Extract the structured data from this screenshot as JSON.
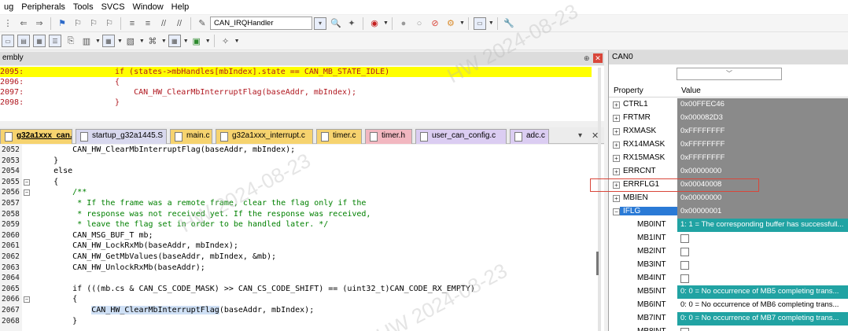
{
  "menu": [
    "ug",
    "Peripherals",
    "Tools",
    "SVCS",
    "Window",
    "Help"
  ],
  "toolbar1": {
    "target_combo": "CAN_IRQHandler"
  },
  "disassembly": {
    "title": "embly",
    "lines": [
      {
        "num": "2095:",
        "code": "if (states->mbHandles[mbIndex].state == CAN_MB_STATE_IDLE)",
        "highlight": true
      },
      {
        "num": "2096:",
        "code": "{"
      },
      {
        "num": "2097:",
        "code": "    CAN_HW_ClearMbInterruptFlag(baseAddr, mbIndex);"
      },
      {
        "num": "2098:",
        "code": "}"
      }
    ]
  },
  "tabs": [
    {
      "label": "g32a1xxx_can.c",
      "color": "#f6d36f",
      "active": true
    },
    {
      "label": "startup_g32a1445.S",
      "color": "#d8d8ee"
    },
    {
      "label": "main.c",
      "color": "#f6d36f"
    },
    {
      "label": "g32a1xxx_interrupt.c",
      "color": "#f6d36f"
    },
    {
      "label": "timer.c",
      "color": "#f6d36f"
    },
    {
      "label": "timer.h",
      "color": "#f2b7c0"
    },
    {
      "label": "user_can_config.c",
      "color": "#dbcdf2"
    },
    {
      "label": "adc.c",
      "color": "#dbcdf2"
    }
  ],
  "editor": {
    "lines": [
      {
        "num": "2052",
        "code": "        CAN_HW_ClearMbInterruptFlag(baseAddr, mbIndex);"
      },
      {
        "num": "2053",
        "code": "    }"
      },
      {
        "num": "2054",
        "code": "    else"
      },
      {
        "num": "2055",
        "code": "    {",
        "fold": true
      },
      {
        "num": "2056",
        "code": "        /**",
        "fold": true,
        "comment": true
      },
      {
        "num": "2057",
        "code": "         * If the frame was a remote frame, clear the flag only if the",
        "comment": true
      },
      {
        "num": "2058",
        "code": "         * response was not received yet. If the response was received,",
        "comment": true
      },
      {
        "num": "2059",
        "code": "         * leave the flag set in order to be handled later. */",
        "comment": true
      },
      {
        "num": "2060",
        "code": "        CAN_MSG_BUF_T mb;"
      },
      {
        "num": "2061",
        "code": "        CAN_HW_LockRxMb(baseAddr, mbIndex);"
      },
      {
        "num": "2062",
        "code": "        CAN_HW_GetMbValues(baseAddr, mbIndex, &mb);"
      },
      {
        "num": "2063",
        "code": "        CAN_HW_UnlockRxMb(baseAddr);"
      },
      {
        "num": "2064",
        "code": ""
      },
      {
        "num": "2065",
        "code": "        if (((mb.cs & CAN_CS_CODE_MASK) >> CAN_CS_CODE_SHIFT) == (uint32_t)CAN_CODE_RX_EMPTY)"
      },
      {
        "num": "2066",
        "code": "        {",
        "fold": true
      },
      {
        "num": "2067",
        "code": "            CAN_HW_ClearMbInterruptFlag(baseAddr, mbIndex);",
        "highlight_call": true
      },
      {
        "num": "2068",
        "code": "        }"
      }
    ]
  },
  "properties": {
    "title": "CAN0",
    "col_property": "Property",
    "col_value": "Value",
    "rows": [
      {
        "name": "CTRL1",
        "value": "0x00FFEC46",
        "style": "gray",
        "exp": "+"
      },
      {
        "name": "FRTMR",
        "value": "0x000082D3",
        "style": "gray",
        "exp": "+"
      },
      {
        "name": "RXMASK",
        "value": "0xFFFFFFFF",
        "style": "gray",
        "exp": "+"
      },
      {
        "name": "RX14MASK",
        "value": "0xFFFFFFFF",
        "style": "gray",
        "exp": "+"
      },
      {
        "name": "RX15MASK",
        "value": "0xFFFFFFFF",
        "style": "gray",
        "exp": "+"
      },
      {
        "name": "ERRCNT",
        "value": "0x00000000",
        "style": "gray",
        "exp": "+"
      },
      {
        "name": "ERRFLG1",
        "value": "0x00040008",
        "style": "gray",
        "exp": "+"
      },
      {
        "name": "MBIEN",
        "value": "0x00000000",
        "style": "gray",
        "exp": "+"
      },
      {
        "name": "IFLG",
        "value": "0x00000001",
        "style": "gray",
        "exp": "-",
        "selected": true
      },
      {
        "name": "MB0INT",
        "value": "1: 1 = The corresponding buffer has successfull...",
        "style": "teal",
        "sub": true
      },
      {
        "name": "MB1INT",
        "value": "",
        "style": "check",
        "sub": true
      },
      {
        "name": "MB2INT",
        "value": "",
        "style": "check",
        "sub": true
      },
      {
        "name": "MB3INT",
        "value": "",
        "style": "check",
        "sub": true
      },
      {
        "name": "MB4INT",
        "value": "",
        "style": "check",
        "sub": true
      },
      {
        "name": "MB5INT",
        "value": "0: 0 = No occurrence of MB5 completing trans...",
        "style": "teal",
        "sub": true
      },
      {
        "name": "MB6INT",
        "value": "0: 0 = No occurrence of MB6 completing trans...",
        "style": "plain",
        "sub": true
      },
      {
        "name": "MB7INT",
        "value": "0: 0 = No occurrence of MB7 completing trans...",
        "style": "teal",
        "sub": true
      },
      {
        "name": "MB8INT",
        "value": "",
        "style": "check",
        "sub": true
      }
    ]
  },
  "watermarks": [
    "HW 2024-08-23"
  ],
  "colors": {
    "highlight_line": "#ffff00",
    "teal": "#21a3a3",
    "gray_value": "#8a8a8a",
    "selection": "#2a7ad6",
    "errflg_outline": "#d9463a"
  }
}
